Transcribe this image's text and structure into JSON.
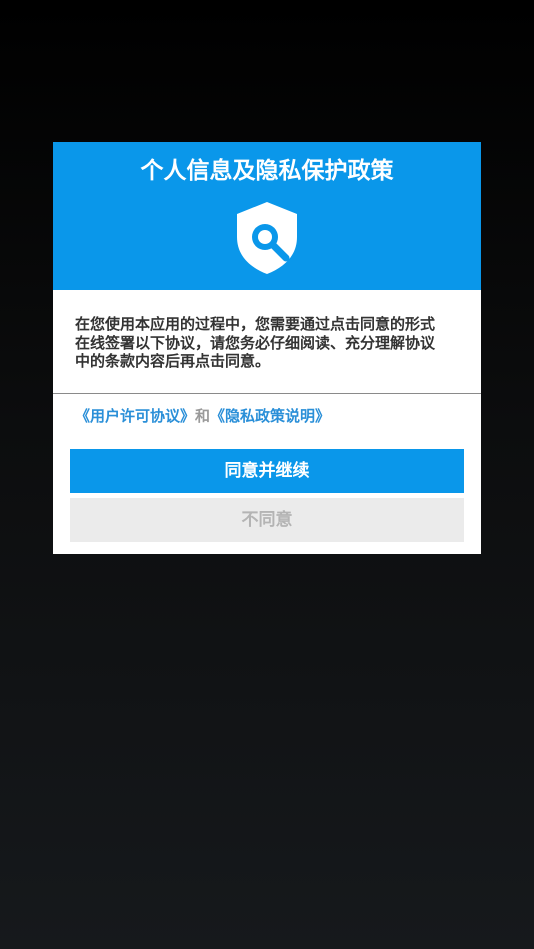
{
  "dialog": {
    "title": "个人信息及隐私保护政策",
    "header_icon": "shield-search-icon",
    "body_lines": [
      "在您使用本应用的过程中，您需要通过点击同意的形式",
      "在线签署以下协议，请您务必仔细阅读、充分理解协议",
      "中的条款内容后再点击同意。"
    ],
    "links": {
      "user_agreement": "《用户许可协议》",
      "joiner": "和",
      "privacy_policy": "《隐私政策说明》"
    },
    "agree_button": "同意并继续",
    "decline_button": "不同意"
  },
  "colors": {
    "accent": "#0a97ea",
    "link": "#2a8fd8",
    "decline_bg": "#ebebeb",
    "decline_text": "#b4b4b4"
  }
}
